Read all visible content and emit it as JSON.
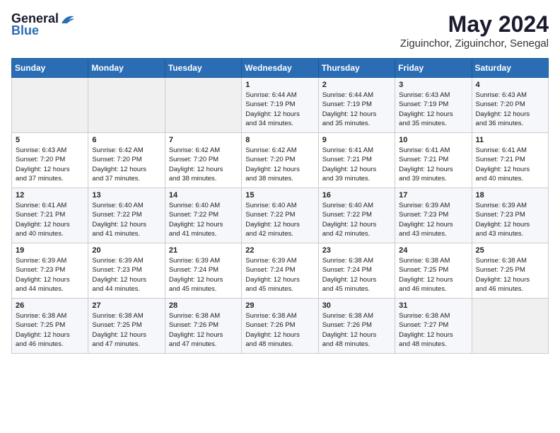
{
  "header": {
    "logo_general": "General",
    "logo_blue": "Blue",
    "title": "May 2024",
    "subtitle": "Ziguinchor, Ziguinchor, Senegal"
  },
  "weekdays": [
    "Sunday",
    "Monday",
    "Tuesday",
    "Wednesday",
    "Thursday",
    "Friday",
    "Saturday"
  ],
  "weeks": [
    [
      {
        "day": "",
        "text": ""
      },
      {
        "day": "",
        "text": ""
      },
      {
        "day": "",
        "text": ""
      },
      {
        "day": "1",
        "text": "Sunrise: 6:44 AM\nSunset: 7:19 PM\nDaylight: 12 hours\nand 34 minutes."
      },
      {
        "day": "2",
        "text": "Sunrise: 6:44 AM\nSunset: 7:19 PM\nDaylight: 12 hours\nand 35 minutes."
      },
      {
        "day": "3",
        "text": "Sunrise: 6:43 AM\nSunset: 7:19 PM\nDaylight: 12 hours\nand 35 minutes."
      },
      {
        "day": "4",
        "text": "Sunrise: 6:43 AM\nSunset: 7:20 PM\nDaylight: 12 hours\nand 36 minutes."
      }
    ],
    [
      {
        "day": "5",
        "text": "Sunrise: 6:43 AM\nSunset: 7:20 PM\nDaylight: 12 hours\nand 37 minutes."
      },
      {
        "day": "6",
        "text": "Sunrise: 6:42 AM\nSunset: 7:20 PM\nDaylight: 12 hours\nand 37 minutes."
      },
      {
        "day": "7",
        "text": "Sunrise: 6:42 AM\nSunset: 7:20 PM\nDaylight: 12 hours\nand 38 minutes."
      },
      {
        "day": "8",
        "text": "Sunrise: 6:42 AM\nSunset: 7:20 PM\nDaylight: 12 hours\nand 38 minutes."
      },
      {
        "day": "9",
        "text": "Sunrise: 6:41 AM\nSunset: 7:21 PM\nDaylight: 12 hours\nand 39 minutes."
      },
      {
        "day": "10",
        "text": "Sunrise: 6:41 AM\nSunset: 7:21 PM\nDaylight: 12 hours\nand 39 minutes."
      },
      {
        "day": "11",
        "text": "Sunrise: 6:41 AM\nSunset: 7:21 PM\nDaylight: 12 hours\nand 40 minutes."
      }
    ],
    [
      {
        "day": "12",
        "text": "Sunrise: 6:41 AM\nSunset: 7:21 PM\nDaylight: 12 hours\nand 40 minutes."
      },
      {
        "day": "13",
        "text": "Sunrise: 6:40 AM\nSunset: 7:22 PM\nDaylight: 12 hours\nand 41 minutes."
      },
      {
        "day": "14",
        "text": "Sunrise: 6:40 AM\nSunset: 7:22 PM\nDaylight: 12 hours\nand 41 minutes."
      },
      {
        "day": "15",
        "text": "Sunrise: 6:40 AM\nSunset: 7:22 PM\nDaylight: 12 hours\nand 42 minutes."
      },
      {
        "day": "16",
        "text": "Sunrise: 6:40 AM\nSunset: 7:22 PM\nDaylight: 12 hours\nand 42 minutes."
      },
      {
        "day": "17",
        "text": "Sunrise: 6:39 AM\nSunset: 7:23 PM\nDaylight: 12 hours\nand 43 minutes."
      },
      {
        "day": "18",
        "text": "Sunrise: 6:39 AM\nSunset: 7:23 PM\nDaylight: 12 hours\nand 43 minutes."
      }
    ],
    [
      {
        "day": "19",
        "text": "Sunrise: 6:39 AM\nSunset: 7:23 PM\nDaylight: 12 hours\nand 44 minutes."
      },
      {
        "day": "20",
        "text": "Sunrise: 6:39 AM\nSunset: 7:23 PM\nDaylight: 12 hours\nand 44 minutes."
      },
      {
        "day": "21",
        "text": "Sunrise: 6:39 AM\nSunset: 7:24 PM\nDaylight: 12 hours\nand 45 minutes."
      },
      {
        "day": "22",
        "text": "Sunrise: 6:39 AM\nSunset: 7:24 PM\nDaylight: 12 hours\nand 45 minutes."
      },
      {
        "day": "23",
        "text": "Sunrise: 6:38 AM\nSunset: 7:24 PM\nDaylight: 12 hours\nand 45 minutes."
      },
      {
        "day": "24",
        "text": "Sunrise: 6:38 AM\nSunset: 7:25 PM\nDaylight: 12 hours\nand 46 minutes."
      },
      {
        "day": "25",
        "text": "Sunrise: 6:38 AM\nSunset: 7:25 PM\nDaylight: 12 hours\nand 46 minutes."
      }
    ],
    [
      {
        "day": "26",
        "text": "Sunrise: 6:38 AM\nSunset: 7:25 PM\nDaylight: 12 hours\nand 46 minutes."
      },
      {
        "day": "27",
        "text": "Sunrise: 6:38 AM\nSunset: 7:25 PM\nDaylight: 12 hours\nand 47 minutes."
      },
      {
        "day": "28",
        "text": "Sunrise: 6:38 AM\nSunset: 7:26 PM\nDaylight: 12 hours\nand 47 minutes."
      },
      {
        "day": "29",
        "text": "Sunrise: 6:38 AM\nSunset: 7:26 PM\nDaylight: 12 hours\nand 48 minutes."
      },
      {
        "day": "30",
        "text": "Sunrise: 6:38 AM\nSunset: 7:26 PM\nDaylight: 12 hours\nand 48 minutes."
      },
      {
        "day": "31",
        "text": "Sunrise: 6:38 AM\nSunset: 7:27 PM\nDaylight: 12 hours\nand 48 minutes."
      },
      {
        "day": "",
        "text": ""
      }
    ]
  ]
}
